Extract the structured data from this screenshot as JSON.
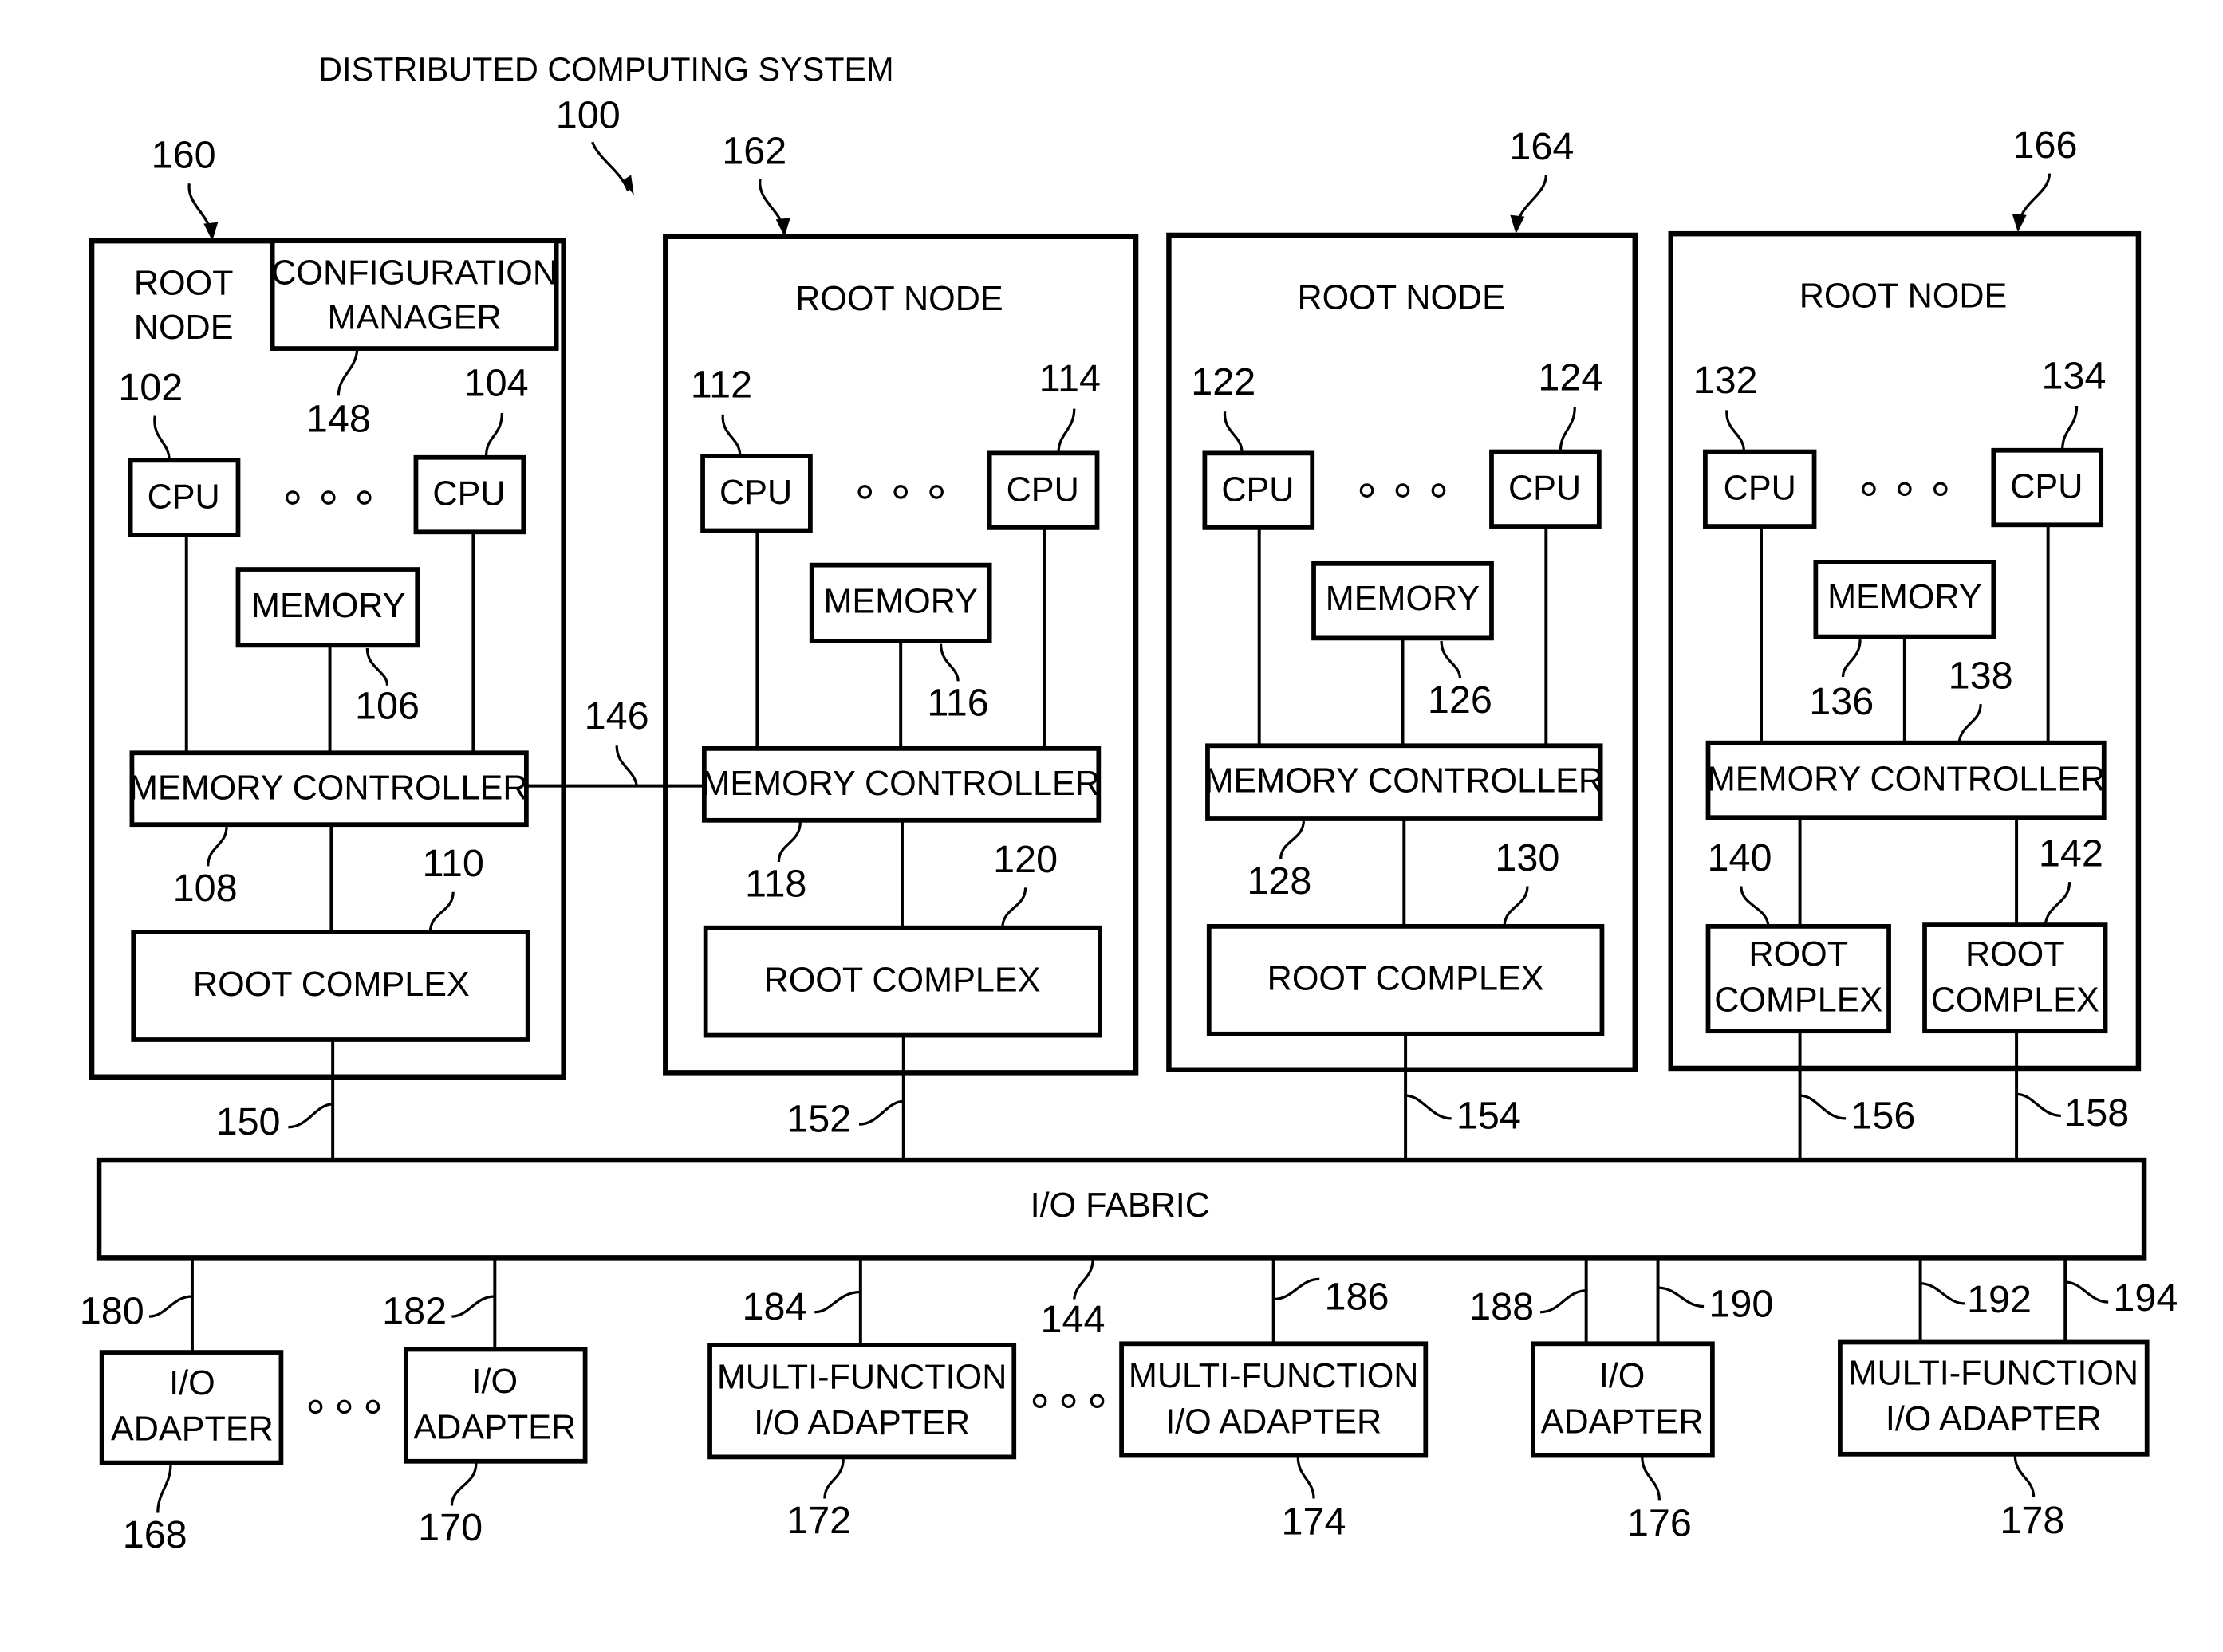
{
  "title": "DISTRIBUTED COMPUTING SYSTEM",
  "system_ref": "100",
  "root_nodes": [
    {
      "ref": "160",
      "label_line1": "ROOT",
      "label_line2": "NODE",
      "config_manager": {
        "line1": "CONFIGURATION",
        "line2": "MANAGER",
        "ref": "148"
      },
      "cpu_left": {
        "label": "CPU",
        "ref": "102"
      },
      "cpu_right": {
        "label": "CPU",
        "ref": "104"
      },
      "memory": {
        "label": "MEMORY",
        "ref": "106"
      },
      "memory_controller": {
        "label": "MEMORY CONTROLLER",
        "ref": "108"
      },
      "root_complex": {
        "label": "ROOT COMPLEX",
        "ref": "110"
      },
      "link_ref": "150"
    },
    {
      "ref": "162",
      "label": "ROOT NODE",
      "cpu_left": {
        "label": "CPU",
        "ref": "112"
      },
      "cpu_right": {
        "label": "CPU",
        "ref": "114"
      },
      "memory": {
        "label": "MEMORY",
        "ref": "116"
      },
      "memory_controller": {
        "label": "MEMORY CONTROLLER",
        "ref": "118"
      },
      "root_complex": {
        "label": "ROOT COMPLEX",
        "ref": "120"
      },
      "link_ref": "152"
    },
    {
      "ref": "164",
      "label": "ROOT NODE",
      "cpu_left": {
        "label": "CPU",
        "ref": "122"
      },
      "cpu_right": {
        "label": "CPU",
        "ref": "124"
      },
      "memory": {
        "label": "MEMORY",
        "ref": "126"
      },
      "memory_controller": {
        "label": "MEMORY CONTROLLER",
        "ref": "128"
      },
      "root_complex": {
        "label": "ROOT COMPLEX",
        "ref": "130"
      },
      "link_ref": "154"
    },
    {
      "ref": "166",
      "label": "ROOT NODE",
      "cpu_left": {
        "label": "CPU",
        "ref": "132"
      },
      "cpu_right": {
        "label": "CPU",
        "ref": "134"
      },
      "memory": {
        "label": "MEMORY",
        "ref": "136"
      },
      "memory_controller": {
        "label": "MEMORY CONTROLLER",
        "ref": "138"
      },
      "root_complex_a": {
        "line1": "ROOT",
        "line2": "COMPLEX",
        "ref": "140",
        "link_ref": "156"
      },
      "root_complex_b": {
        "line1": "ROOT",
        "line2": "COMPLEX",
        "ref": "142",
        "link_ref": "158"
      }
    }
  ],
  "mc_link_ref": "146",
  "io_fabric": {
    "label": "I/O FABRIC",
    "ref": "144"
  },
  "ellipsis": "∘ ∘ ∘",
  "adapters": [
    {
      "line1": "I/O",
      "line2": "ADAPTER",
      "ref": "168",
      "link_ref": "180"
    },
    {
      "line1": "I/O",
      "line2": "ADAPTER",
      "ref": "170",
      "link_ref": "182"
    },
    {
      "line1": "MULTI-FUNCTION",
      "line2": "I/O ADAPTER",
      "ref": "172",
      "link_ref": "184"
    },
    {
      "line1": "MULTI-FUNCTION",
      "line2": "I/O ADAPTER",
      "ref": "174",
      "link_ref": "186"
    },
    {
      "line1": "I/O",
      "line2": "ADAPTER",
      "ref": "176",
      "link_ref_a": "188",
      "link_ref_b": "190"
    },
    {
      "line1": "MULTI-FUNCTION",
      "line2": "I/O ADAPTER",
      "ref": "178",
      "link_ref_a": "192",
      "link_ref_b": "194"
    }
  ]
}
